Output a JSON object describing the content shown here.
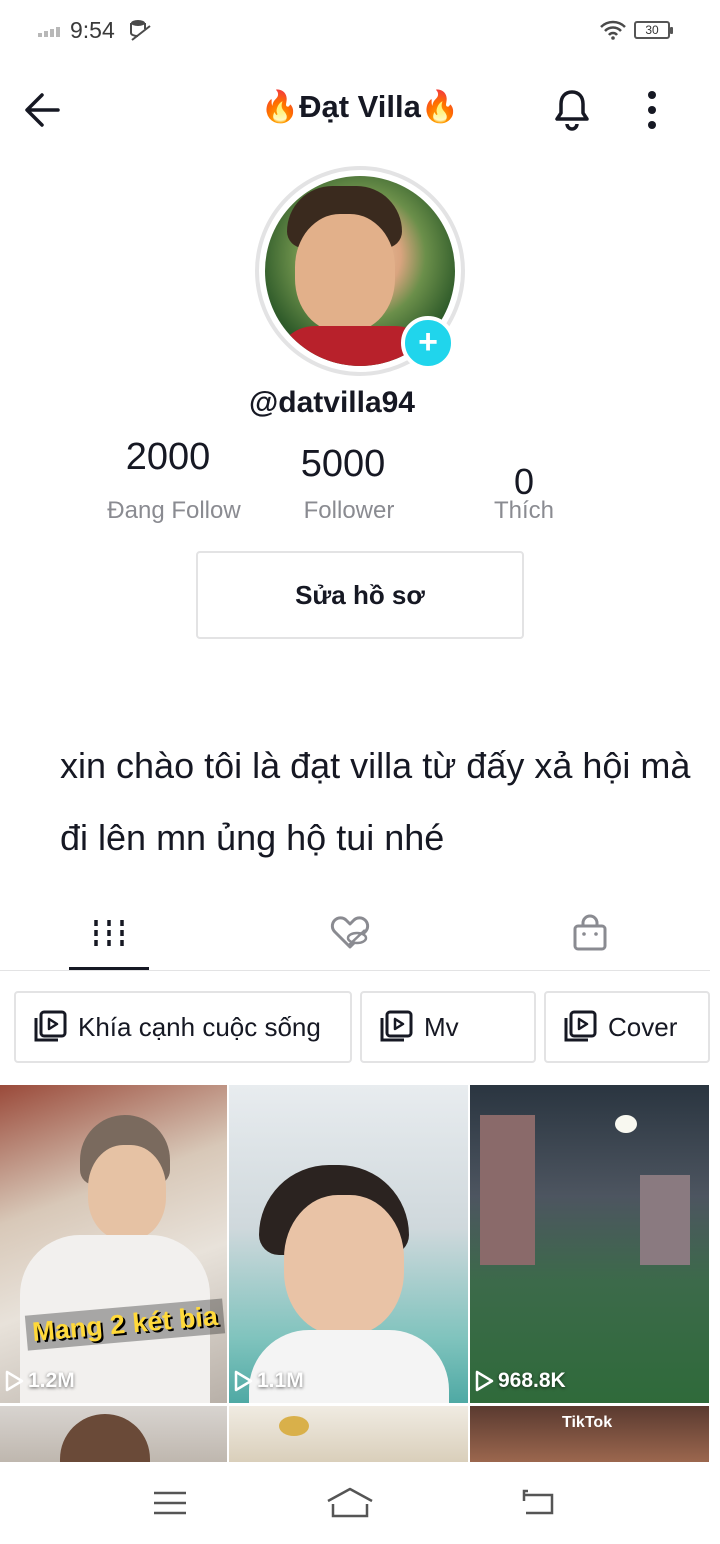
{
  "status_bar": {
    "time": "9:54",
    "battery": "30"
  },
  "header": {
    "title": "🔥Đạt Villa🔥"
  },
  "profile": {
    "username": "@datvilla94",
    "bio": "xin chào tôi là đạt villa từ đấy xả hội mà đi lên mn ủng hộ tui nhé"
  },
  "stats": [
    {
      "value": "2000",
      "label": "Đang Follow"
    },
    {
      "value": "5000",
      "label": "Follower"
    },
    {
      "value": "0",
      "label": "Thích"
    }
  ],
  "edit_profile_label": "Sửa hồ sơ",
  "playlists": [
    {
      "label": "Khía cạnh cuộc sống"
    },
    {
      "label": "Mv"
    },
    {
      "label": "Cover"
    }
  ],
  "videos": [
    {
      "views": "1.2M",
      "caption": "Mang 2 két bia"
    },
    {
      "views": "1.1M"
    },
    {
      "views": "968.8K"
    }
  ],
  "watermark": "TikTok",
  "colors": {
    "accent": "#20d5ec",
    "text": "#161823",
    "muted": "#8a8b91",
    "border": "#e3e3e4"
  }
}
